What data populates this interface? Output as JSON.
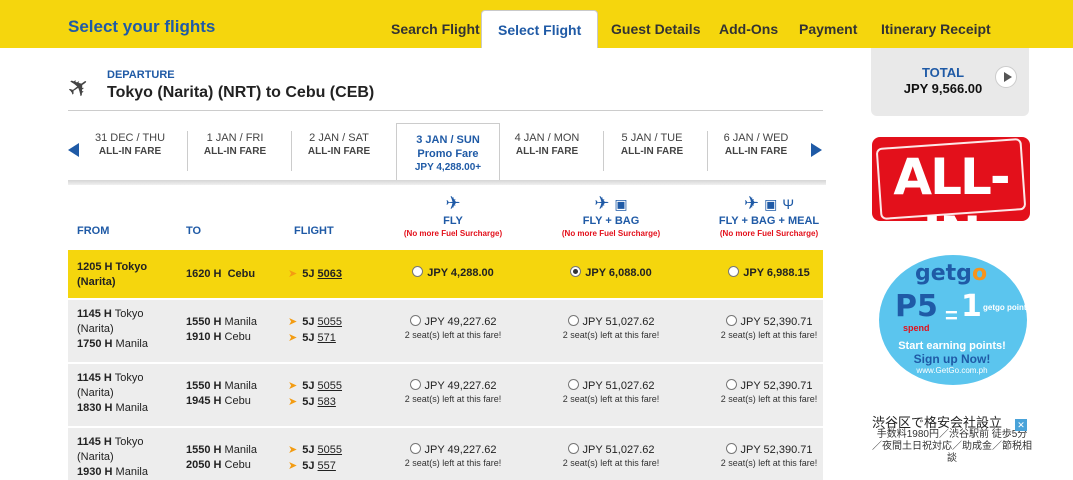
{
  "header": {
    "title": "Select your flights",
    "steps": [
      "Search Flight",
      "Select Flight",
      "Guest Details",
      "Add-Ons",
      "Payment",
      "Itinerary Receipt"
    ]
  },
  "total": {
    "label": "TOTAL",
    "value": "JPY  9,566.00"
  },
  "ads": {
    "allin": "ALL-IN",
    "getgo": {
      "logo_a": "getg",
      "logo_b": "o",
      "p5": "P5",
      "spend": "spend",
      "eq": "=",
      "one": "1",
      "point": "getgo point",
      "earn": "Start earning points!",
      "signup": "Sign up Now!",
      "url": "www.GetGo.com.ph"
    },
    "jp_title": "渋谷区で格安会社設立",
    "jp_body": "手数料1980円／渋谷駅前 徒歩5分／夜間土日祝対応／助成金／節税相談"
  },
  "departure": {
    "label": "DEPARTURE",
    "route": "Tokyo (Narita)  (NRT) to  Cebu  (CEB)"
  },
  "dates": [
    {
      "date": "31 DEC / THU",
      "fare": "ALL-IN FARE"
    },
    {
      "date": "1 JAN / FRI",
      "fare": "ALL-IN FARE"
    },
    {
      "date": "2 JAN / SAT",
      "fare": "ALL-IN FARE"
    },
    {
      "date": "3 JAN / SUN",
      "fare": "Promo Fare",
      "price": "JPY 4,288.00+"
    },
    {
      "date": "4 JAN / MON",
      "fare": "ALL-IN FARE"
    },
    {
      "date": "5 JAN / TUE",
      "fare": "ALL-IN FARE"
    },
    {
      "date": "6 JAN / WED",
      "fare": "ALL-IN FARE"
    }
  ],
  "table": {
    "headers": {
      "from": "FROM",
      "to": "TO",
      "flight": "FLIGHT"
    },
    "fares": [
      {
        "name": "FLY",
        "note": "(No more Fuel Surcharge)"
      },
      {
        "name": "FLY + BAG",
        "note": "(No more Fuel Surcharge)"
      },
      {
        "name": "FLY + BAG + MEAL",
        "note": "(No more Fuel Surcharge)"
      }
    ],
    "rows": [
      {
        "from": [
          {
            "time": "1205 H",
            "place": "Tokyo"
          },
          {
            "time": "",
            "place": "(Narita)"
          }
        ],
        "to": [
          {
            "time": "1620 H",
            "place": "Cebu"
          }
        ],
        "flights": [
          {
            "code": "5J",
            "num": "5063"
          }
        ],
        "prices": [
          "JPY 4,288.00",
          "JPY 6,088.00",
          "JPY 6,988.15"
        ],
        "seats": [
          "",
          "",
          ""
        ]
      },
      {
        "from": [
          {
            "time": "1145 H",
            "place": "Tokyo"
          },
          {
            "time": "",
            "place": "(Narita)"
          },
          {
            "time": "1750 H",
            "place": "Manila"
          }
        ],
        "to": [
          {
            "time": "1550 H",
            "place": "Manila"
          },
          {
            "time": "1910 H",
            "place": "Cebu"
          }
        ],
        "flights": [
          {
            "code": "5J",
            "num": "5055"
          },
          {
            "code": "5J",
            "num": "571"
          }
        ],
        "prices": [
          "JPY 49,227.62",
          "JPY 51,027.62",
          "JPY 52,390.71"
        ],
        "seats": [
          "2 seat(s) left at this fare!",
          "2 seat(s) left at this fare!",
          "2 seat(s) left at this fare!"
        ]
      },
      {
        "from": [
          {
            "time": "1145 H",
            "place": "Tokyo"
          },
          {
            "time": "",
            "place": "(Narita)"
          },
          {
            "time": "1830 H",
            "place": "Manila"
          }
        ],
        "to": [
          {
            "time": "1550 H",
            "place": "Manila"
          },
          {
            "time": "1945 H",
            "place": "Cebu"
          }
        ],
        "flights": [
          {
            "code": "5J",
            "num": "5055"
          },
          {
            "code": "5J",
            "num": "583"
          }
        ],
        "prices": [
          "JPY 49,227.62",
          "JPY 51,027.62",
          "JPY 52,390.71"
        ],
        "seats": [
          "2 seat(s) left at this fare!",
          "2 seat(s) left at this fare!",
          "2 seat(s) left at this fare!"
        ]
      },
      {
        "from": [
          {
            "time": "1145 H",
            "place": "Tokyo"
          },
          {
            "time": "",
            "place": "(Narita)"
          },
          {
            "time": "1930 H",
            "place": "Manila"
          }
        ],
        "to": [
          {
            "time": "1550 H",
            "place": "Manila"
          },
          {
            "time": "2050 H",
            "place": "Cebu"
          }
        ],
        "flights": [
          {
            "code": "5J",
            "num": "5055"
          },
          {
            "code": "5J",
            "num": "557"
          }
        ],
        "prices": [
          "JPY 49,227.62",
          "JPY 51,027.62",
          "JPY 52,390.71"
        ],
        "seats": [
          "2 seat(s) left at this fare!",
          "2 seat(s) left at this fare!",
          "2 seat(s) left at this fare!"
        ]
      }
    ]
  }
}
